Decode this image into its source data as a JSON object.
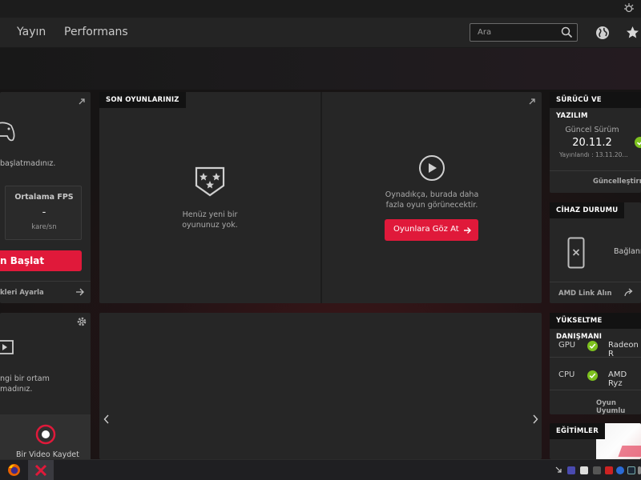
{
  "nav": {
    "tabs": [
      "Yayın",
      "Performans"
    ],
    "search_placeholder": "Ara"
  },
  "gaming": {
    "left_message": "başlatmadınız.",
    "fps_label": "Ortalama FPS",
    "fps_value": "-",
    "fps_unit": "kare/sn",
    "start_button": "n Başlat",
    "settings_link": "kleri Ayarla"
  },
  "recent_games": {
    "title": "SON OYUNLARINIZ",
    "empty_text_1": "Henüz yeni bir",
    "empty_text_2": "oyununuz yok.",
    "play_text_1": "Oynadıkça, burada daha",
    "play_text_2": "fazla oyun görünecektir.",
    "browse_button": "Oyunlara Göz At"
  },
  "driver": {
    "title": "SÜRÜCÜ VE YAZILIM",
    "current_label": "Güncel Sürüm",
    "version": "20.11.2",
    "released": "Yayınlandı : 13.11.20…",
    "update_link": "Güncelleştirme"
  },
  "device": {
    "title": "CİHAZ DURUMU",
    "status": "Bağlanı",
    "link": "AMD Link Alın"
  },
  "upgrade": {
    "title": "YÜKSELTME DANIŞMANI",
    "rows": [
      {
        "label": "GPU",
        "value": "Radeon R"
      },
      {
        "label": "CPU",
        "value": "AMD Ryz"
      }
    ],
    "link": "Oyun Uyumlu"
  },
  "record": {
    "text_1": "ngi bir ortam",
    "text_2": "madınız.",
    "button_label": "Bir Video Kaydet"
  },
  "training": {
    "title": "EĞİTİMLER"
  },
  "colors": {
    "accent": "#e0193a",
    "panel": "#262626",
    "check": "#7dc11f"
  }
}
